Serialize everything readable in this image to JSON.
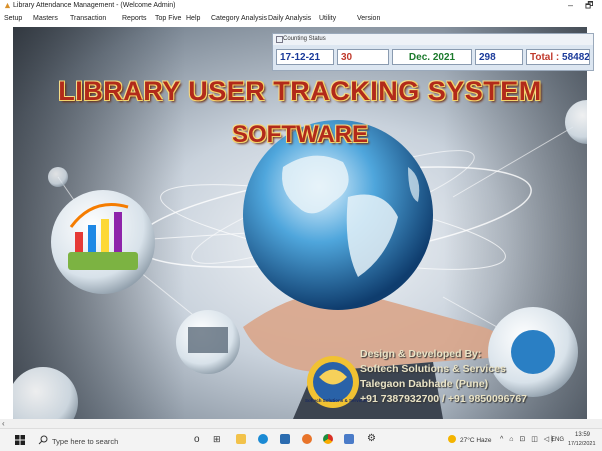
{
  "window": {
    "title": "Library Attendance Management - (Welcome Admin)",
    "minimize_glyph": "–",
    "restore_glyph": "🗗"
  },
  "menu": {
    "items": [
      "Setup",
      "Masters",
      "Transaction",
      "Reports",
      "Top Five",
      "Help",
      "Category Analysis",
      "Daily Analysis",
      "Utility",
      "Version"
    ]
  },
  "banner": {
    "line1": "LIBRARY USER TRACKING SYSTEM",
    "line2": "SOFTWARE"
  },
  "counting_status": {
    "title": "Counting Status",
    "date": "17-12-21",
    "day_count": "30",
    "month": "Dec. 2021",
    "month_count": "298",
    "total_label": "Total :",
    "total_value": "58482"
  },
  "credits": {
    "line1": "Design & Developed By:",
    "line2": "Softech Solutions & Services",
    "line3": "Talegaon Dabhade (Pune)",
    "line4": "+91 7387932700 / +91 9850096767",
    "logo_text": "Softech Solutions & Services"
  },
  "taskbar": {
    "search_placeholder": "Type here to search",
    "weather": "27°C  Haze",
    "language": "ENG",
    "time": "13:59",
    "date": "17/12/2021"
  },
  "colors": {
    "banner_red": "#b22a1a",
    "counter_blue": "#1a3a9a",
    "counter_red": "#c0392b",
    "counter_green": "#1c7a2c"
  },
  "icons": [
    "app-icon",
    "windows-start-icon",
    "search-icon",
    "cortana-icon",
    "task-view-icon",
    "file-explorer-icon",
    "edge-icon",
    "mail-icon",
    "firefox-icon",
    "chrome-icon",
    "settings-icon",
    "weather-icon"
  ]
}
